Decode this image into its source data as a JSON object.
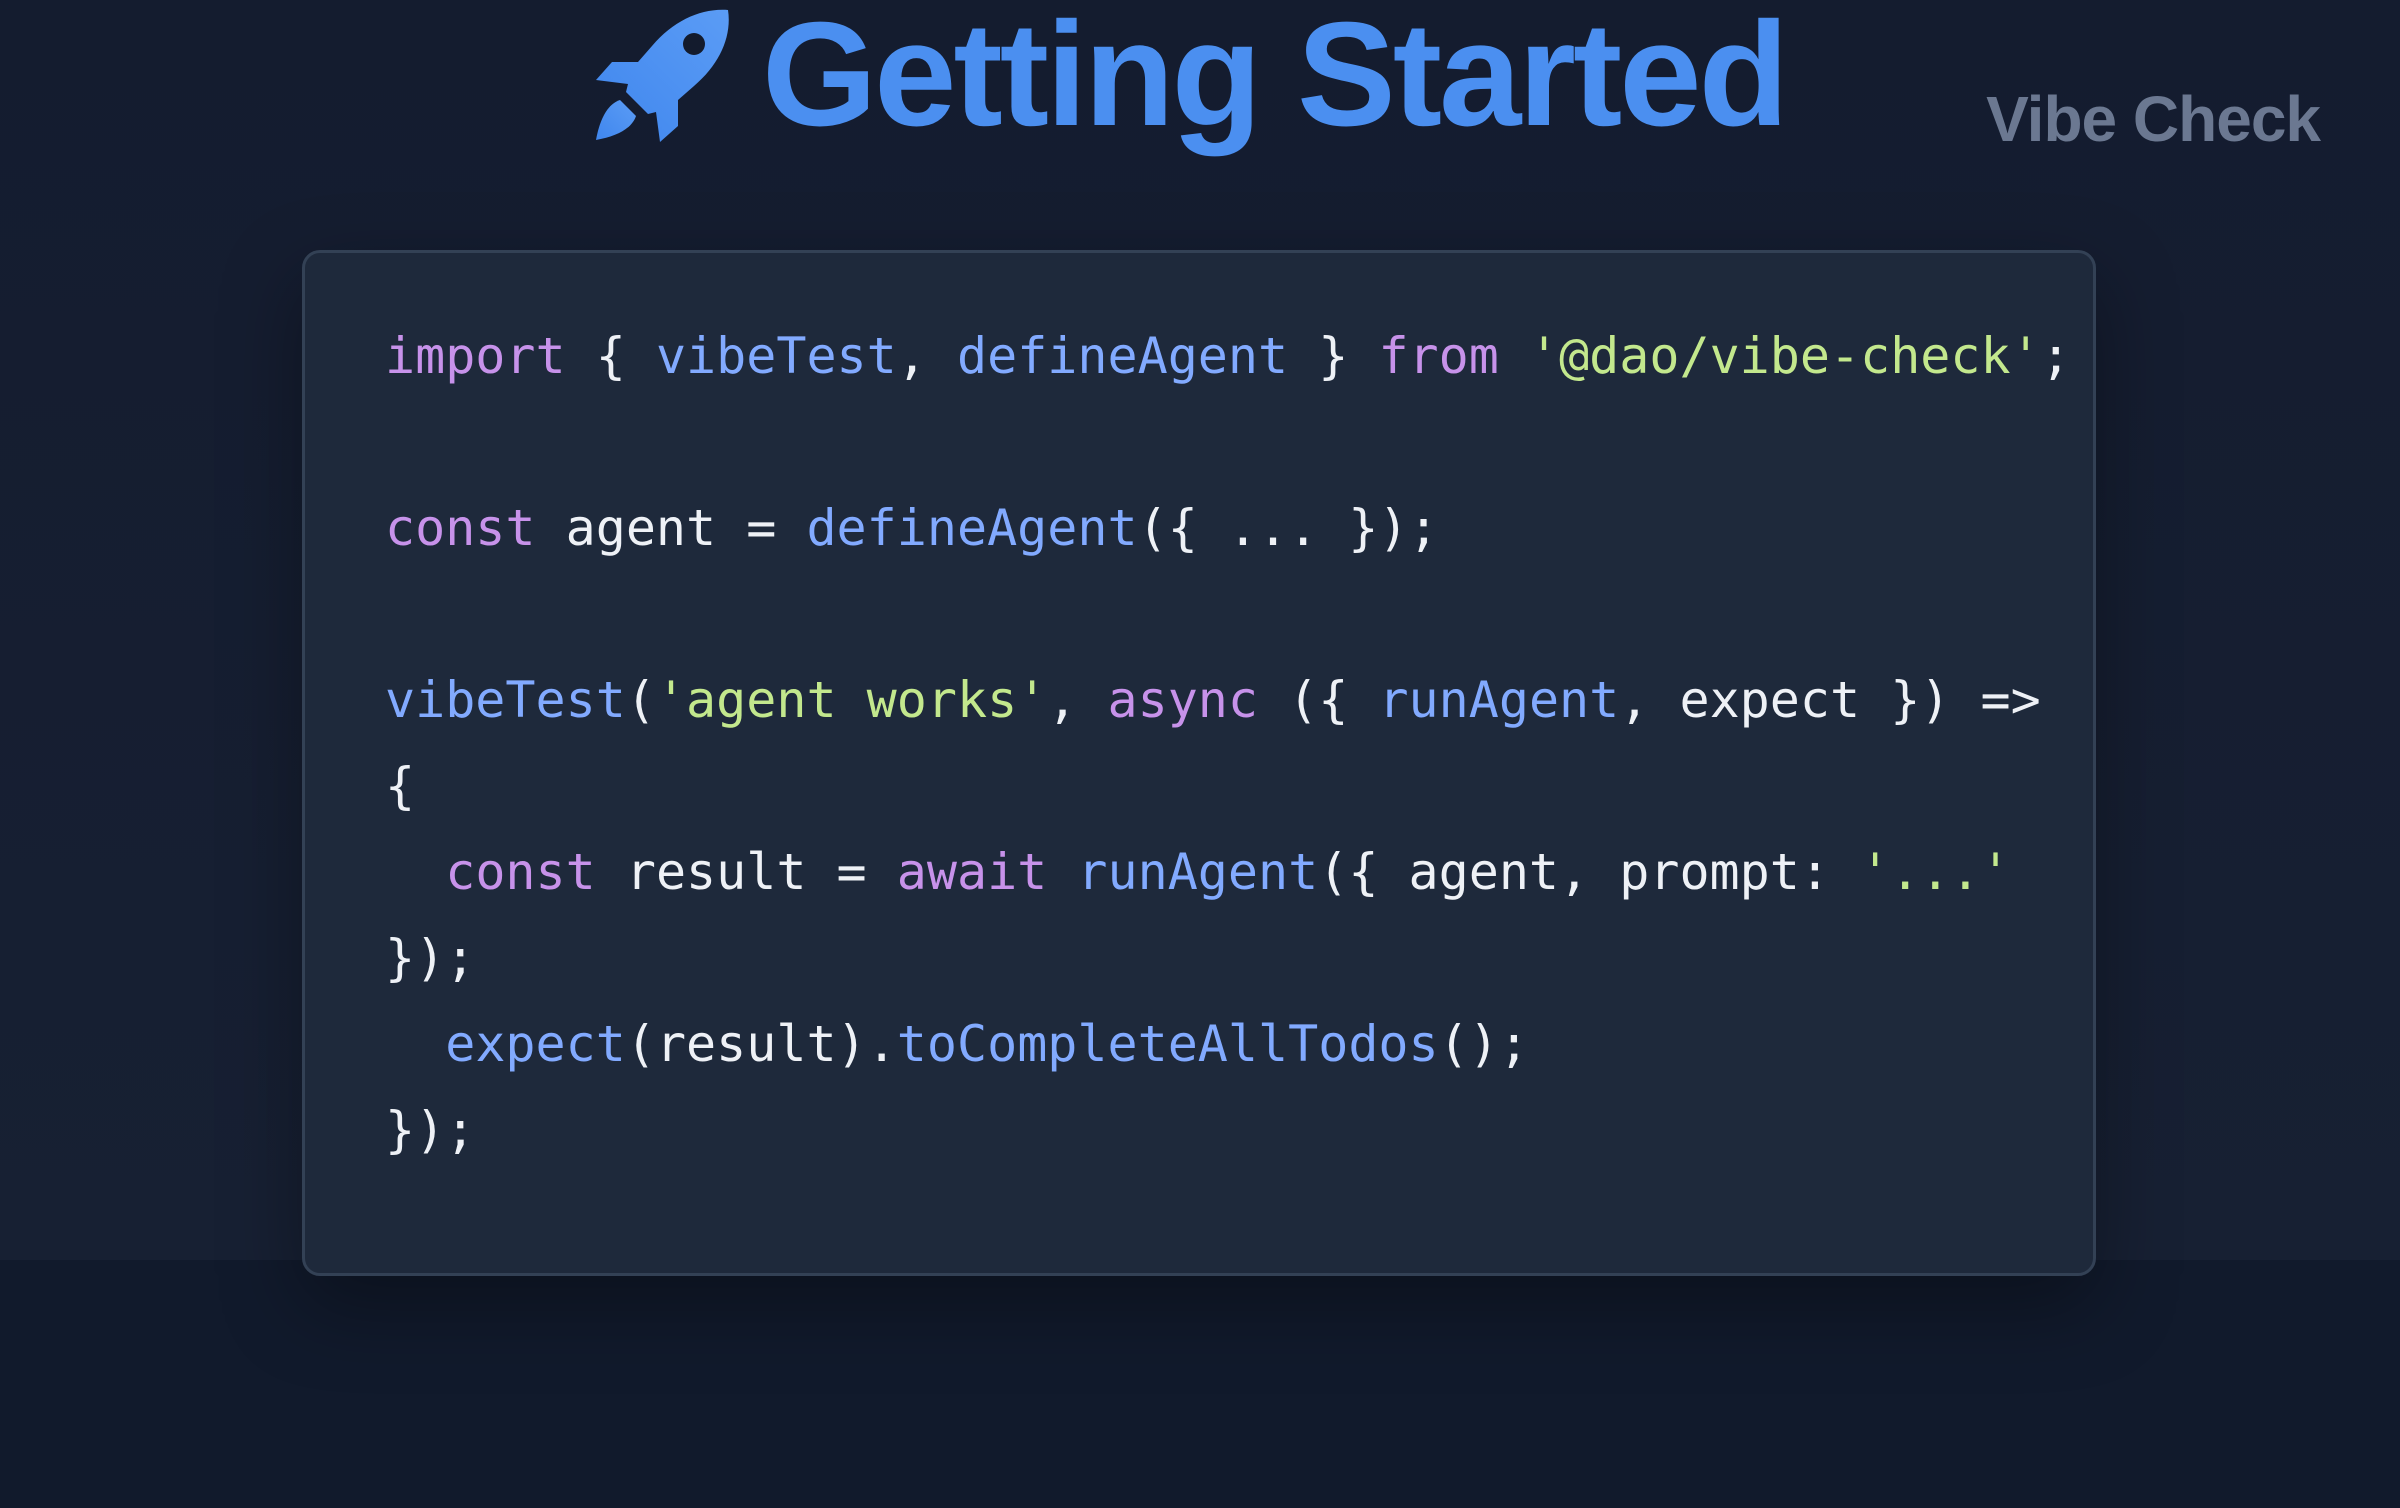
{
  "header": {
    "title": "Getting Started",
    "icon": "rocket-icon",
    "brand": "Vibe Check"
  },
  "colors": {
    "title": "#4b8ff0",
    "brand": "#6b7891",
    "card_background": "#1e293b",
    "keyword": "#c792ea",
    "function": "#82aaff",
    "string": "#c3e88d",
    "plain": "#eef1f6"
  },
  "code_block": {
    "language": "javascript",
    "lines": [
      [
        {
          "t": "import",
          "k": "kw"
        },
        {
          "t": " { ",
          "k": "pl"
        },
        {
          "t": "vibeTest",
          "k": "fn"
        },
        {
          "t": ", ",
          "k": "pl"
        },
        {
          "t": "defineAgent",
          "k": "fn"
        },
        {
          "t": " } ",
          "k": "pl"
        },
        {
          "t": "from",
          "k": "kw"
        },
        {
          "t": " ",
          "k": "pl"
        },
        {
          "t": "'@dao/vibe-check'",
          "k": "str"
        },
        {
          "t": ";",
          "k": "pl"
        }
      ],
      [],
      [
        {
          "t": "const",
          "k": "kw"
        },
        {
          "t": " agent = ",
          "k": "pl"
        },
        {
          "t": "defineAgent",
          "k": "fn"
        },
        {
          "t": "({ ... });",
          "k": "pl"
        }
      ],
      [],
      [
        {
          "t": "vibeTest",
          "k": "fn"
        },
        {
          "t": "(",
          "k": "pl"
        },
        {
          "t": "'agent works'",
          "k": "str"
        },
        {
          "t": ", ",
          "k": "pl"
        },
        {
          "t": "async",
          "k": "kw"
        },
        {
          "t": " ({ ",
          "k": "pl"
        },
        {
          "t": "runAgent",
          "k": "fn"
        },
        {
          "t": ", expect }) =>",
          "k": "pl"
        }
      ],
      [
        {
          "t": "{",
          "k": "pl"
        }
      ],
      [
        {
          "t": "  ",
          "k": "pl"
        },
        {
          "t": "const",
          "k": "kw"
        },
        {
          "t": " result = ",
          "k": "pl"
        },
        {
          "t": "await",
          "k": "kw"
        },
        {
          "t": " ",
          "k": "pl"
        },
        {
          "t": "runAgent",
          "k": "fn"
        },
        {
          "t": "({ agent, prompt: ",
          "k": "pl"
        },
        {
          "t": "'...'",
          "k": "str"
        }
      ],
      [
        {
          "t": "});",
          "k": "pl"
        }
      ],
      [
        {
          "t": "  ",
          "k": "pl"
        },
        {
          "t": "expect",
          "k": "fn"
        },
        {
          "t": "(result).",
          "k": "pl"
        },
        {
          "t": "toCompleteAllTodos",
          "k": "fn"
        },
        {
          "t": "();",
          "k": "pl"
        }
      ],
      [
        {
          "t": "});",
          "k": "pl"
        }
      ]
    ]
  }
}
